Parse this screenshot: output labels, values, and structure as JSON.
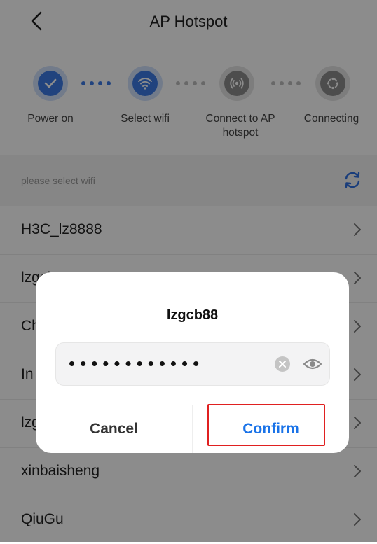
{
  "header": {
    "title": "AP Hotspot"
  },
  "steps": [
    {
      "label": "Power on",
      "icon": "check-icon"
    },
    {
      "label": "Select wifi",
      "icon": "wifi-icon"
    },
    {
      "label": "Connect to AP hotspot",
      "icon": "signal-icon"
    },
    {
      "label": "Connecting",
      "icon": "sync-icon"
    }
  ],
  "list": {
    "hint": "please select wifi",
    "items": [
      {
        "name": "H3C_lz8888"
      },
      {
        "name": "lzgcb885g"
      },
      {
        "name": "Ch"
      },
      {
        "name": "In"
      },
      {
        "name": "lzg"
      },
      {
        "name": "xinbaisheng"
      },
      {
        "name": "QiuGu"
      }
    ]
  },
  "dialog": {
    "title": "lzgcb88",
    "password_mask": "••••••••••••",
    "cancel_label": "Cancel",
    "confirm_label": "Confirm"
  },
  "colors": {
    "accent": "#1a73e8",
    "step_active": "#3d7be6",
    "step_inactive": "#8c8c8c",
    "highlight": "#e02020"
  }
}
